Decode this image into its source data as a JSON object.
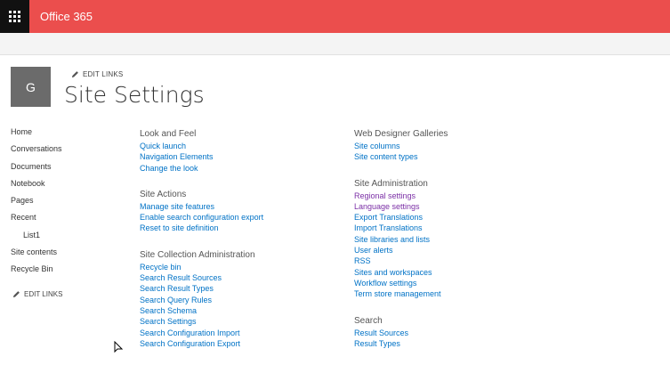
{
  "suite": {
    "brand": "Office 365"
  },
  "header": {
    "logo_letter": "G",
    "edit_links": "EDIT LINKS",
    "title": "Site Settings"
  },
  "leftnav": {
    "items": [
      {
        "label": "Home"
      },
      {
        "label": "Conversations"
      },
      {
        "label": "Documents"
      },
      {
        "label": "Notebook"
      },
      {
        "label": "Pages"
      },
      {
        "label": "Recent"
      },
      {
        "label": "List1",
        "sub": true
      },
      {
        "label": "Site contents"
      },
      {
        "label": "Recycle Bin"
      }
    ],
    "edit_links": "EDIT LINKS"
  },
  "columns": {
    "left": [
      {
        "title": "Look and Feel",
        "links": [
          "Quick launch",
          "Navigation Elements",
          "Change the look"
        ]
      },
      {
        "title": "Site Actions",
        "links": [
          "Manage site features",
          "Enable search configuration export",
          "Reset to site definition"
        ]
      },
      {
        "title": "Site Collection Administration",
        "links": [
          "Recycle bin",
          "Search Result Sources",
          "Search Result Types",
          "Search Query Rules",
          "Search Schema",
          "Search Settings",
          "Search Configuration Import",
          "Search Configuration Export"
        ]
      }
    ],
    "right": [
      {
        "title": "Web Designer Galleries",
        "links": [
          "Site columns",
          "Site content types"
        ]
      },
      {
        "title": "Site Administration",
        "links": [
          "Regional settings",
          "Language settings",
          "Export Translations",
          "Import Translations",
          "Site libraries and lists",
          "User alerts",
          "RSS",
          "Sites and workspaces",
          "Workflow settings",
          "Term store management"
        ]
      },
      {
        "title": "Search",
        "links": [
          "Result Sources",
          "Result Types"
        ]
      }
    ]
  },
  "colors": {
    "suite_bar": "#eb4e4d",
    "link": "#0072c6",
    "visited_link": "#7b2fa6"
  },
  "icons": [
    "waffle-icon",
    "pencil-icon",
    "mouse-cursor-icon"
  ]
}
